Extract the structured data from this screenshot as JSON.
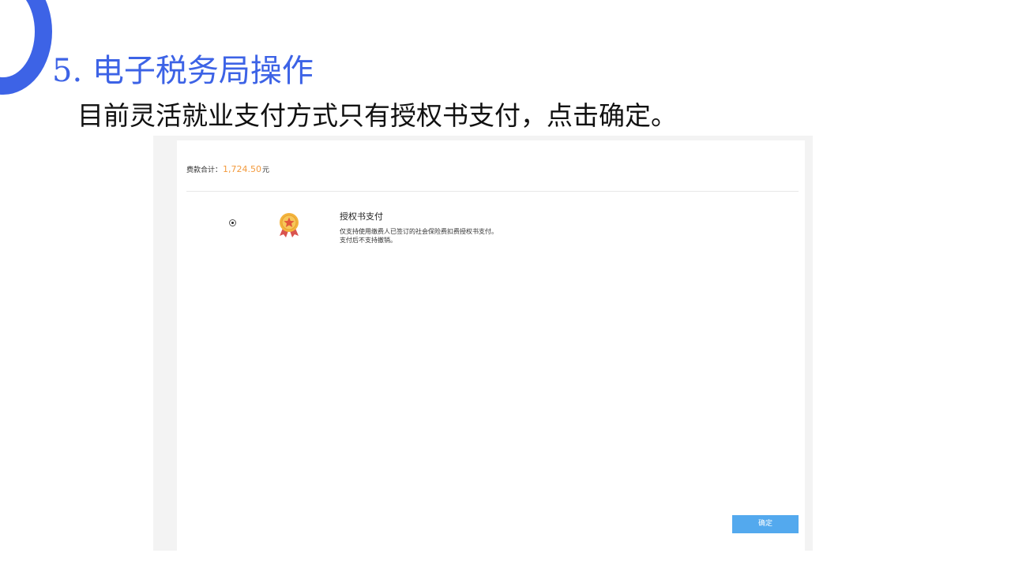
{
  "slide": {
    "title": "5. 电子税务局操作",
    "body": "目前灵活就业支付方式只有授权书支付，点击确定。",
    "accent_color": "#3d63e6"
  },
  "screenshot": {
    "fee_label": "费款合计：",
    "fee_amount": "1,724.50",
    "fee_unit": "元",
    "amount_color": "#f39a3d",
    "payment_method": {
      "selected": true,
      "icon": "medal-icon",
      "title": "授权书支付",
      "description": "仅支持使用缴费人已签订的社会保险费扣费授权书支付。支付后不支持撤销。"
    },
    "confirm_label": "确定",
    "button_color": "#53a9ee"
  }
}
